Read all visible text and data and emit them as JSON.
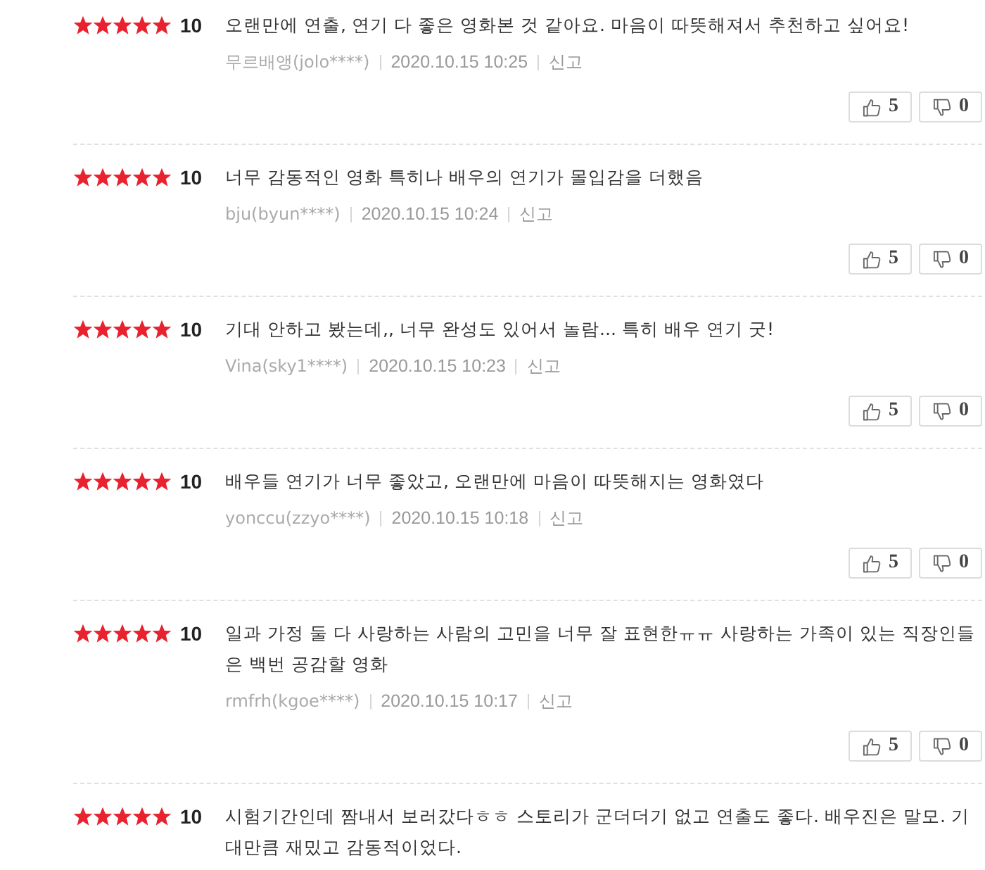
{
  "reviews": [
    {
      "stars": 5,
      "score": "10",
      "text": "오랜만에 연출, 연기 다 좋은 영화본 것 같아요. 마음이 따뜻해져서 추천하고 싶어요!",
      "author": "무르배앵(jolo****)",
      "date": "2020.10.15 10:25",
      "report": "신고",
      "likes": "5",
      "dislikes": "0"
    },
    {
      "stars": 5,
      "score": "10",
      "text": "너무 감동적인 영화 특히나 배우의 연기가 몰입감을 더했음",
      "author": "bju(byun****)",
      "date": "2020.10.15 10:24",
      "report": "신고",
      "likes": "5",
      "dislikes": "0"
    },
    {
      "stars": 5,
      "score": "10",
      "text": "기대 안하고 봤는데,, 너무 완성도 있어서 놀람... 특히 배우 연기 굿!",
      "author": "Vina(sky1****)",
      "date": "2020.10.15 10:23",
      "report": "신고",
      "likes": "5",
      "dislikes": "0"
    },
    {
      "stars": 5,
      "score": "10",
      "text": "배우들 연기가 너무 좋았고, 오랜만에 마음이 따뜻해지는 영화였다",
      "author": "yonccu(zzyo****)",
      "date": "2020.10.15 10:18",
      "report": "신고",
      "likes": "5",
      "dislikes": "0"
    },
    {
      "stars": 5,
      "score": "10",
      "text": "일과 가정 둘 다 사랑하는 사람의 고민을 너무 잘 표현한ㅠㅠ 사랑하는 가족이 있는 직장인들은 백번 공감할 영화",
      "author": "rmfrh(kgoe****)",
      "date": "2020.10.15 10:17",
      "report": "신고",
      "likes": "5",
      "dislikes": "0"
    },
    {
      "stars": 5,
      "score": "10",
      "text": "시험기간인데 짬내서 보러갔다ㅎㅎ 스토리가 군더더기 없고 연출도 좋다. 배우진은 말모. 기대만큼 재밌고 감동적이었다."
    }
  ]
}
